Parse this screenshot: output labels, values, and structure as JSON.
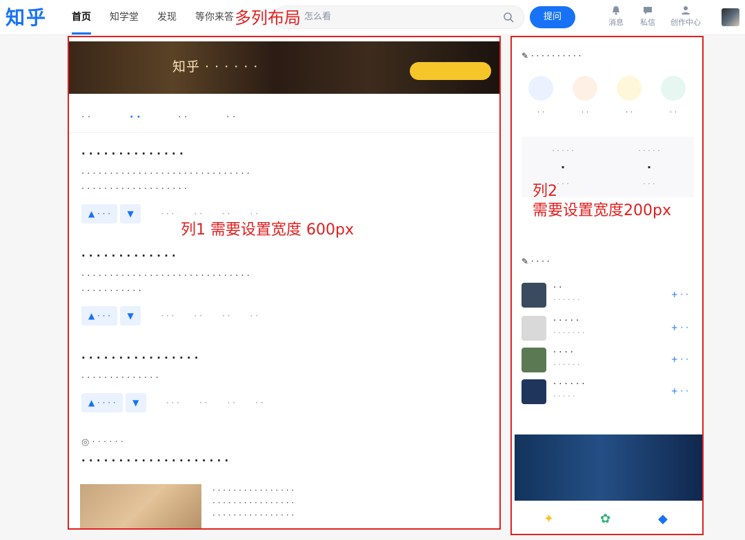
{
  "header": {
    "logo": "知乎",
    "nav": [
      "首页",
      "知学堂",
      "发现",
      "等你来答"
    ],
    "search_placeholder": "怎么看",
    "ask_button": "提问",
    "tools": [
      "消息",
      "私信",
      "创作中心"
    ]
  },
  "annotations": {
    "top": "多列布局",
    "col1": "列1 需要设置宽度 600px",
    "col2": "列2\n需要设置宽度200px"
  },
  "colors": {
    "brand": "#1772f6",
    "annotation": "#e02020"
  }
}
